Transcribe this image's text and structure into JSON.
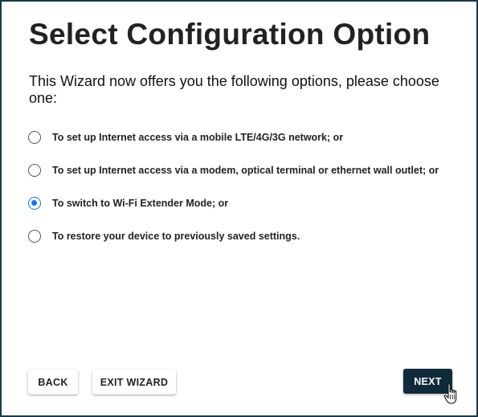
{
  "page": {
    "title": "Select Configuration Option",
    "intro": "This Wizard now offers you the following options, please choose one:"
  },
  "options": [
    {
      "label": "To set up Internet access via a mobile LTE/4G/3G network; or",
      "selected": false
    },
    {
      "label": "To set up Internet access via a modem, optical terminal or ethernet wall outlet; or",
      "selected": false
    },
    {
      "label": "To switch to Wi-Fi Extender Mode; or",
      "selected": true
    },
    {
      "label": "To restore your device to previously saved settings.",
      "selected": false
    }
  ],
  "footer": {
    "back_label": "BACK",
    "exit_label": "EXIT WIZARD",
    "next_label": "NEXT"
  },
  "colors": {
    "frame_border": "#1b3a4b",
    "accent": "#1a73e8",
    "primary_button": "#0f2a3a"
  },
  "icons": {
    "cursor": "hand-pointer-icon"
  }
}
